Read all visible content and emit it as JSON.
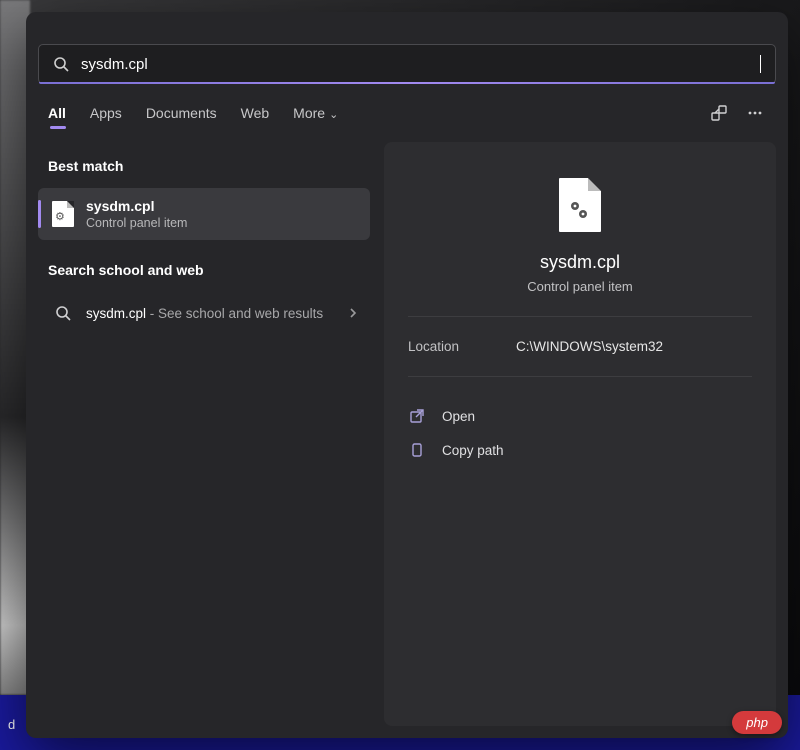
{
  "search": {
    "query": "sysdm.cpl"
  },
  "tabs": {
    "all": "All",
    "apps": "Apps",
    "documents": "Documents",
    "web": "Web",
    "more": "More"
  },
  "left": {
    "best_match_heading": "Best match",
    "result": {
      "title": "sysdm.cpl",
      "subtitle": "Control panel item"
    },
    "search_web_heading": "Search school and web",
    "web_result": {
      "title": "sysdm.cpl",
      "tail": " - See school and web results"
    }
  },
  "preview": {
    "title": "sysdm.cpl",
    "subtitle": "Control panel item",
    "location_label": "Location",
    "location_value": "C:\\WINDOWS\\system32",
    "action_open": "Open",
    "action_copy_path": "Copy path"
  },
  "taskbar_fragment": "d",
  "watermark": "php"
}
